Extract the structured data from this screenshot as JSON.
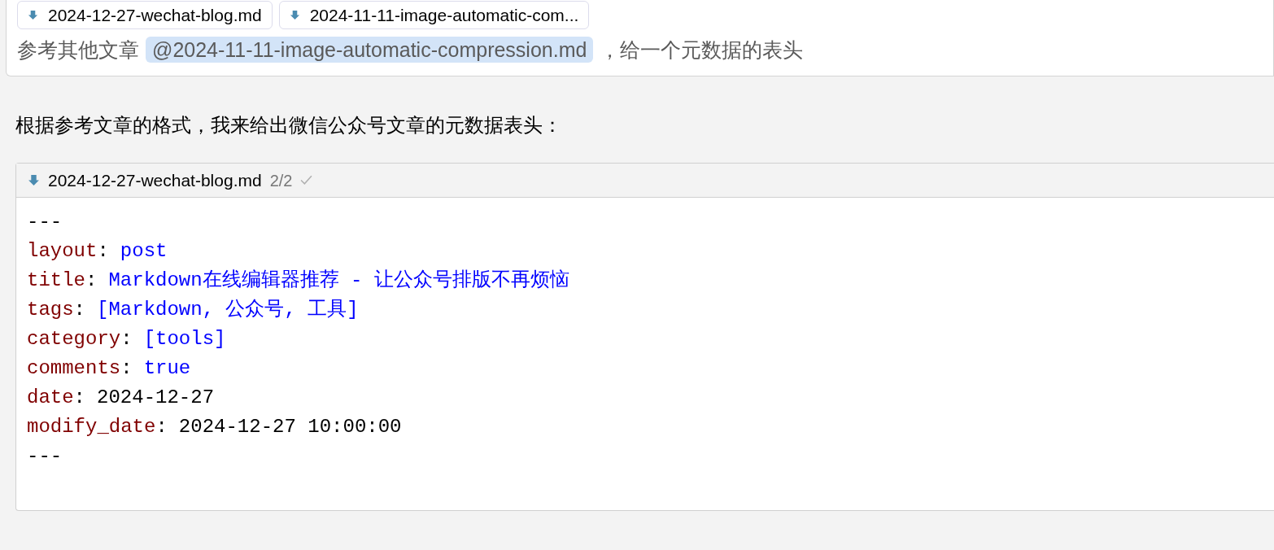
{
  "attachments": [
    {
      "name": "2024-12-27-wechat-blog.md"
    },
    {
      "name": "2024-11-11-image-automatic-com..."
    }
  ],
  "prompt": [
    {
      "kind": "text",
      "text": "参考其他文章"
    },
    {
      "kind": "mention",
      "text": "@2024-11-11-image-automatic-compression.md"
    },
    {
      "kind": "text",
      "text": "，给一个元数据的表头"
    }
  ],
  "response": "根据参考文章的格式，我来给出微信公众号文章的元数据表头：",
  "code_block": {
    "file": "2024-12-27-wechat-blog.md",
    "counter": "2/2",
    "applied": true,
    "lines": [
      {
        "tokens": [
          {
            "kind": "plain",
            "text": "---"
          }
        ]
      },
      {
        "tokens": [
          {
            "kind": "key",
            "text": "layout"
          },
          {
            "kind": "punct",
            "text": ":"
          },
          {
            "kind": "literal",
            "text": "post"
          }
        ]
      },
      {
        "tokens": [
          {
            "kind": "key",
            "text": "title"
          },
          {
            "kind": "punct",
            "text": ":"
          },
          {
            "kind": "literal",
            "text": "Markdown在线编辑器推荐 - 让公众号排版不再烦恼"
          }
        ]
      },
      {
        "tokens": [
          {
            "kind": "key",
            "text": "tags"
          },
          {
            "kind": "punct",
            "text": ":"
          },
          {
            "kind": "literal",
            "text": "[Markdown, 公众号, 工具]"
          }
        ]
      },
      {
        "tokens": [
          {
            "kind": "key",
            "text": "category"
          },
          {
            "kind": "punct",
            "text": ":"
          },
          {
            "kind": "literal",
            "text": "[tools]"
          }
        ]
      },
      {
        "tokens": [
          {
            "kind": "key",
            "text": "comments"
          },
          {
            "kind": "punct",
            "text": ":"
          },
          {
            "kind": "literal",
            "text": "true"
          }
        ]
      },
      {
        "tokens": [
          {
            "kind": "key",
            "text": "date"
          },
          {
            "kind": "punct",
            "text": ":"
          },
          {
            "kind": "plain",
            "text": "2024-12-27"
          }
        ]
      },
      {
        "tokens": [
          {
            "kind": "key",
            "text": "modify_date"
          },
          {
            "kind": "punct",
            "text": ":"
          },
          {
            "kind": "plain",
            "text": "2024-12-27 10:00:00"
          }
        ]
      },
      {
        "tokens": [
          {
            "kind": "plain",
            "text": "---"
          }
        ]
      }
    ]
  }
}
